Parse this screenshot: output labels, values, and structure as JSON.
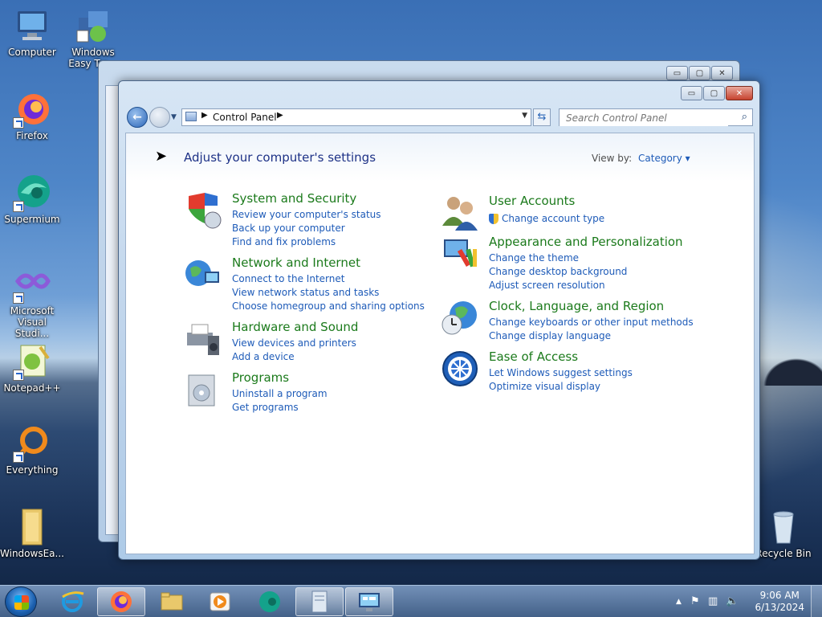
{
  "desktop": {
    "icons": [
      {
        "label": "Computer"
      },
      {
        "label": "Windows Easy Tra..."
      },
      {
        "label": "Firefox"
      },
      {
        "label": "Supermium"
      },
      {
        "label": "Microsoft Visual Studi..."
      },
      {
        "label": "Notepad++"
      },
      {
        "label": "Everything"
      },
      {
        "label": "WindowsEa..."
      },
      {
        "label": "Recycle Bin"
      }
    ]
  },
  "window": {
    "caption_buttons": {
      "minimize": "▭",
      "maximize": "▢",
      "close": "✕"
    },
    "address": {
      "crumb": "Control Panel"
    },
    "search": {
      "placeholder": "Search Control Panel"
    },
    "title": "Adjust your computer's settings",
    "view_by_label": "View by:",
    "view_by_value": "Category ▾",
    "categories": [
      {
        "title": "System and Security",
        "icon": "shield-icon",
        "links": [
          "Review your computer's status",
          "Back up your computer",
          "Find and fix problems"
        ]
      },
      {
        "title": "Network and Internet",
        "icon": "globe-network-icon",
        "links": [
          "Connect to the Internet",
          "View network status and tasks",
          "Choose homegroup and sharing options"
        ]
      },
      {
        "title": "Hardware and Sound",
        "icon": "printer-speaker-icon",
        "links": [
          "View devices and printers",
          "Add a device"
        ]
      },
      {
        "title": "Programs",
        "icon": "programs-box-icon",
        "links": [
          "Uninstall a program",
          "Get programs"
        ]
      },
      {
        "title": "User Accounts",
        "icon": "users-icon",
        "links": [
          "Change account type"
        ]
      },
      {
        "title": "Appearance and Personalization",
        "icon": "monitor-paint-icon",
        "links": [
          "Change the theme",
          "Change desktop background",
          "Adjust screen resolution"
        ]
      },
      {
        "title": "Clock, Language, and Region",
        "icon": "globe-clock-icon",
        "links": [
          "Change keyboards or other input methods",
          "Change display language"
        ]
      },
      {
        "title": "Ease of Access",
        "icon": "ease-of-access-icon",
        "links": [
          "Let Windows suggest settings",
          "Optimize visual display"
        ]
      }
    ]
  },
  "taskbar": {
    "clock": {
      "time": "9:06 AM",
      "date": "6/13/2024"
    }
  },
  "colors": {
    "category_title": "#1b7a1b",
    "link": "#1e5bb8",
    "page_title": "#1e3287"
  }
}
